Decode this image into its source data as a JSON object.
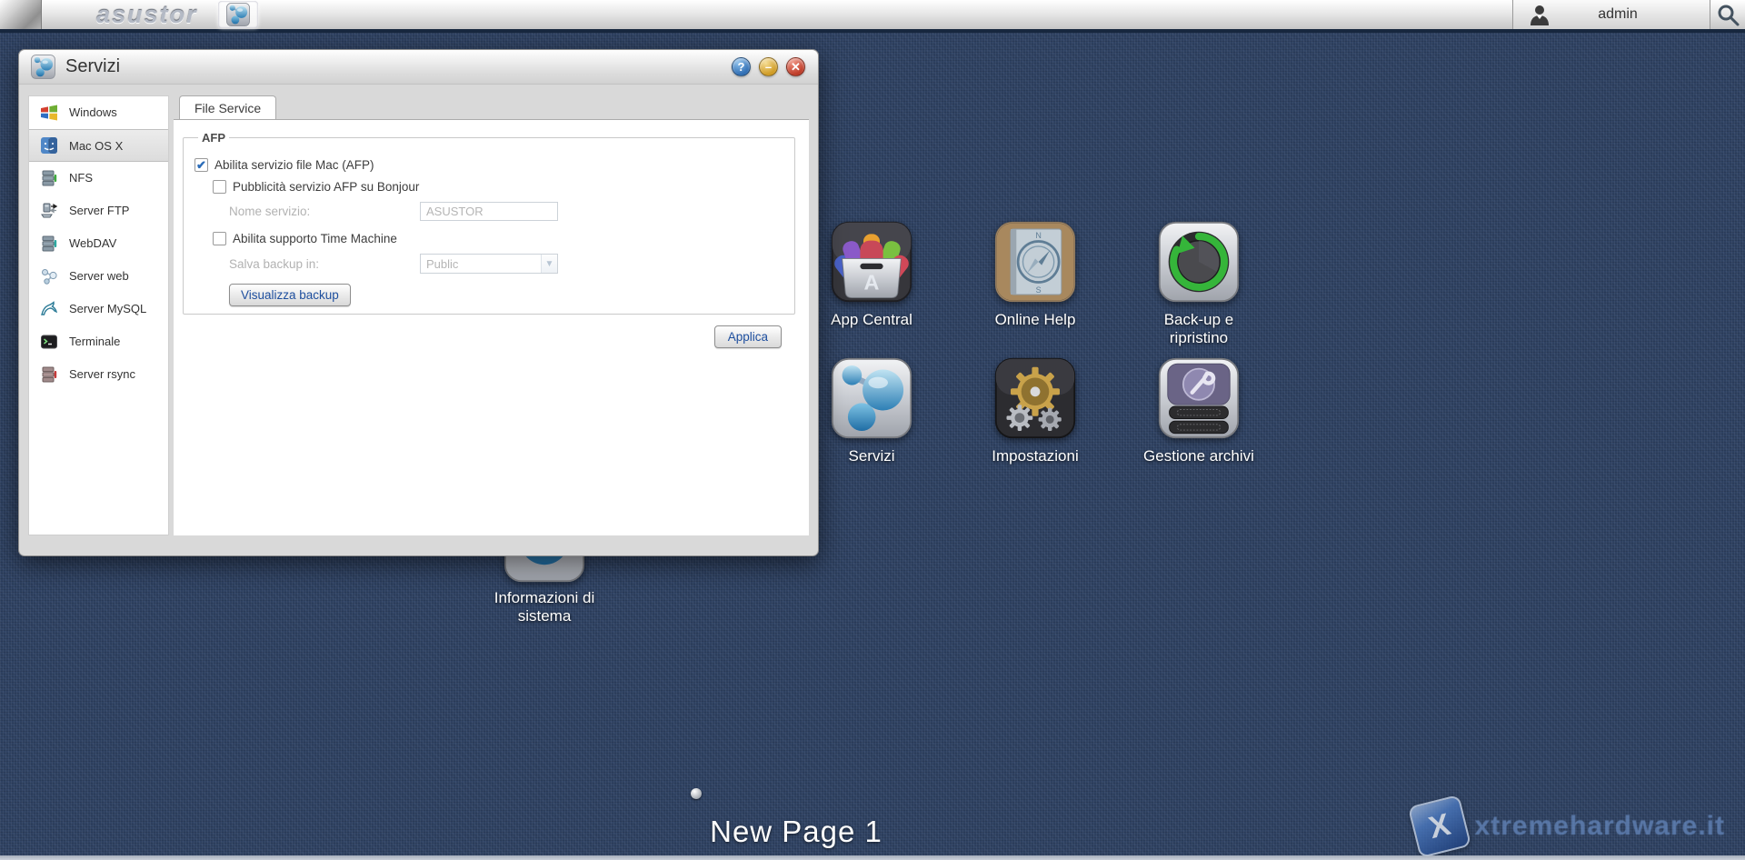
{
  "topbar": {
    "logo": "asustor",
    "running_app": "Servizi",
    "user": "admin",
    "icons": {
      "user": "person-icon",
      "search": "magnifier-icon"
    }
  },
  "window": {
    "title": "Servizi",
    "controls": {
      "help": "?",
      "minimize": "–",
      "close": "✕"
    },
    "sidebar": {
      "selected_index": 1,
      "items": [
        {
          "icon": "windows-icon",
          "label": "Windows"
        },
        {
          "icon": "mac-os-icon",
          "label": "Mac OS X"
        },
        {
          "icon": "nfs-server-icon",
          "label": "NFS"
        },
        {
          "icon": "ftp-server-icon",
          "label": "Server FTP"
        },
        {
          "icon": "webdav-server-icon",
          "label": "WebDAV"
        },
        {
          "icon": "web-server-icon",
          "label": "Server web"
        },
        {
          "icon": "mysql-icon",
          "label": "Server MySQL"
        },
        {
          "icon": "terminal-icon",
          "label": "Terminale"
        },
        {
          "icon": "rsync-server-icon",
          "label": "Server rsync"
        }
      ]
    },
    "tabs": [
      {
        "label": "File Service"
      }
    ],
    "panel": {
      "fieldset_legend": "AFP",
      "afp_enabled": {
        "label": "Abilita servizio file Mac (AFP)",
        "checked": true,
        "glyph": "✔"
      },
      "bonjour": {
        "label": "Pubblicità servizio AFP su Bonjour",
        "checked": false,
        "glyph": ""
      },
      "service_name": {
        "label": "Nome servizio:",
        "value": "ASUSTOR",
        "disabled": true
      },
      "time_machine": {
        "label": "Abilita supporto Time Machine",
        "checked": false,
        "glyph": ""
      },
      "backup_dest": {
        "label": "Salva backup in:",
        "value": "Public",
        "disabled": true,
        "arrow": "▼"
      },
      "view_backup_label": "Visualizza backup",
      "apply_label": "Applica"
    }
  },
  "desktop": {
    "icons": [
      {
        "icon": "app-central-icon",
        "label": "App Central"
      },
      {
        "icon": "online-help-icon",
        "label": "Online Help"
      },
      {
        "icon": "backup-restore-icon",
        "label": "Back-up e ripristino"
      },
      {
        "icon": "services-icon",
        "label": "Servizi"
      },
      {
        "icon": "settings-icon",
        "label": "Impostazioni"
      },
      {
        "icon": "storage-manager-icon",
        "label": "Gestione archivi"
      }
    ],
    "partial_icon": {
      "icon": "system-info-icon",
      "label": "Informazioni di sistema"
    },
    "page_indicator": "dot",
    "page_label": "New Page 1",
    "watermark": {
      "x": "X",
      "text": "xtremehardware.it"
    }
  },
  "colors": {
    "desktop_bg": "#2e4161",
    "topbar_border": "#17273e",
    "accent_blue": "#1d4e9e",
    "check_blue": "#2b6cb8",
    "help_btn": "#2f6db3",
    "min_btn": "#cf9a22",
    "close_btn": "#bd3a26",
    "backup_green": "#35b53a",
    "gear_gold": "#c9a24a"
  }
}
